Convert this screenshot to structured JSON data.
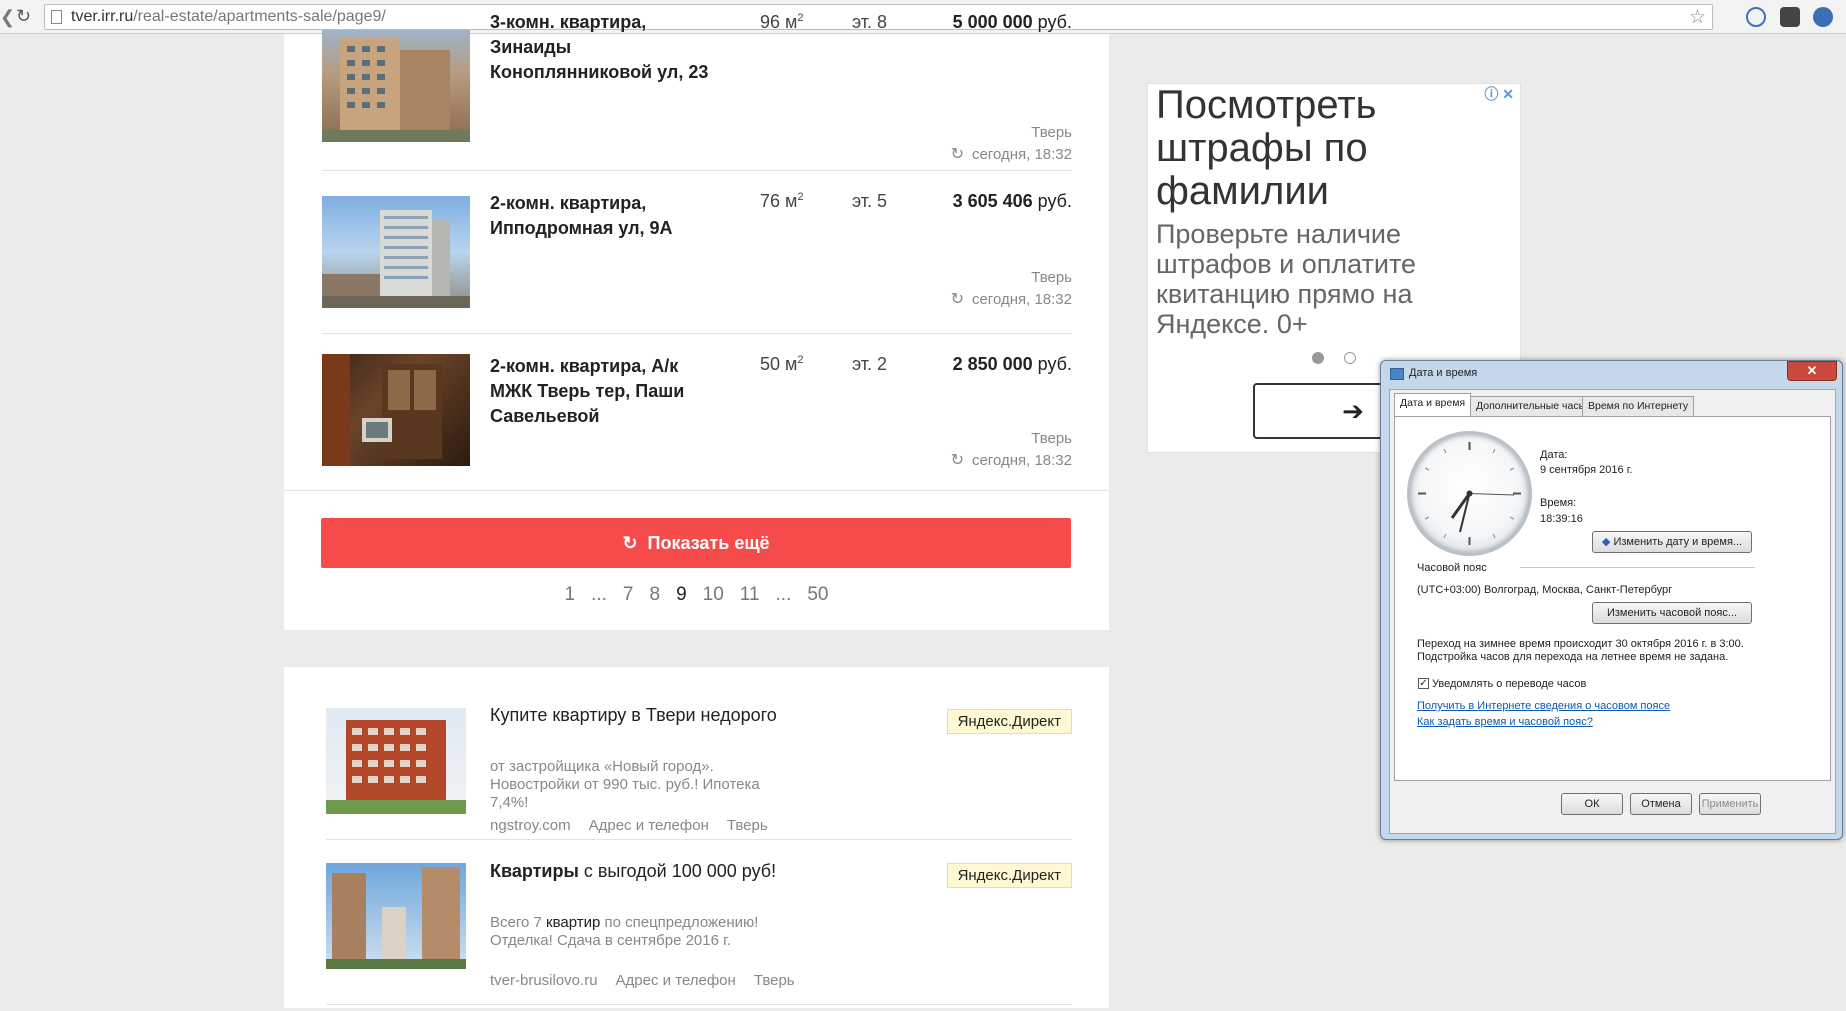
{
  "browser": {
    "url_host": "tver.irr.ru",
    "url_path": "/real-estate/apartments-sale/page9/",
    "back_icon": "arrow-left-icon",
    "reload_icon": "reload-icon",
    "star_icon": "star-icon"
  },
  "listings": [
    {
      "title": "3-комн. квартира, Зинаиды Коноплянниковой ул, 23",
      "area": "96 м",
      "floor": "эт. 8",
      "price_value": "5 000 000",
      "price_unit": "руб.",
      "city": "Тверь",
      "updated": "сегодня, 18:32"
    },
    {
      "title": "2-комн. квартира, Ипподромная ул, 9А",
      "area": "76 м",
      "floor": "эт. 5",
      "price_value": "3 605 406",
      "price_unit": "руб.",
      "city": "Тверь",
      "updated": "сегодня, 18:32"
    },
    {
      "title": "2-комн. квартира, А/к МЖК Тверь тер, Паши Савельевой",
      "area": "50 м",
      "floor": "эт. 2",
      "price_value": "2 850 000",
      "price_unit": "руб.",
      "city": "Тверь",
      "updated": "сегодня, 18:32"
    }
  ],
  "area_sup": "2",
  "show_more": "Показать ещё",
  "pagination": [
    "1",
    "...",
    "7",
    "8",
    "9",
    "10",
    "11",
    "...",
    "50"
  ],
  "current_page": "9",
  "direct_ads": [
    {
      "title": "Купите квартиру в Твери недорого",
      "desc": "от застройщика «Новый город». Новостройки от 990 тыс. руб.! Ипотека 7,4%!",
      "domain": "ngstroy.com",
      "contacts": "Адрес и телефон",
      "city": "Тверь",
      "badge": "Яндекс.Директ"
    },
    {
      "title_pre": "Квартиры",
      "title_post": " с выгодой 100 000 руб!",
      "desc_pre": "Всего 7 ",
      "desc_bold": "квартир",
      "desc_post": " по спецпредложению! Отделка! Сдача в сентябре 2016 г.",
      "domain": "tver-brusilovo.ru",
      "contacts": "Адрес и телефон",
      "city": "Тверь",
      "badge": "Яндекс.Директ"
    }
  ],
  "side_ad": {
    "headline": "Посмотреть штрафы по фамилии",
    "body": "Проверьте наличие штрафов и оплатите квитанцию прямо на Яндексе. 0+",
    "button_icon": "arrow-right-icon",
    "info_icon": "info-icon",
    "close_icon": "close-icon"
  },
  "dialog": {
    "title": "Дата и время",
    "tabs": [
      "Дата и время",
      "Дополнительные часы",
      "Время по Интернету"
    ],
    "date_label": "Дата:",
    "date_value": "9 сентября 2016 г.",
    "time_label": "Время:",
    "time_value": "18:39:16",
    "change_datetime": "Изменить дату и время...",
    "tz_section": "Часовой пояс",
    "tz_value": "(UTC+03:00) Волгоград, Москва, Санкт-Петербург",
    "change_tz": "Изменить часовой пояс...",
    "dst_line1": "Переход на зимнее время происходит 30 октября 2016 г. в 3:00.",
    "dst_line2": "Подстройка часов для перехода на летнее время не задана.",
    "notify_label": "Уведомлять о переводе часов",
    "notify_checked": true,
    "link1": "Получить в Интернете сведения о часовом поясе",
    "link2": "Как задать время и часовой пояс?",
    "ok": "ОК",
    "cancel": "Отмена",
    "apply": "Применить"
  }
}
